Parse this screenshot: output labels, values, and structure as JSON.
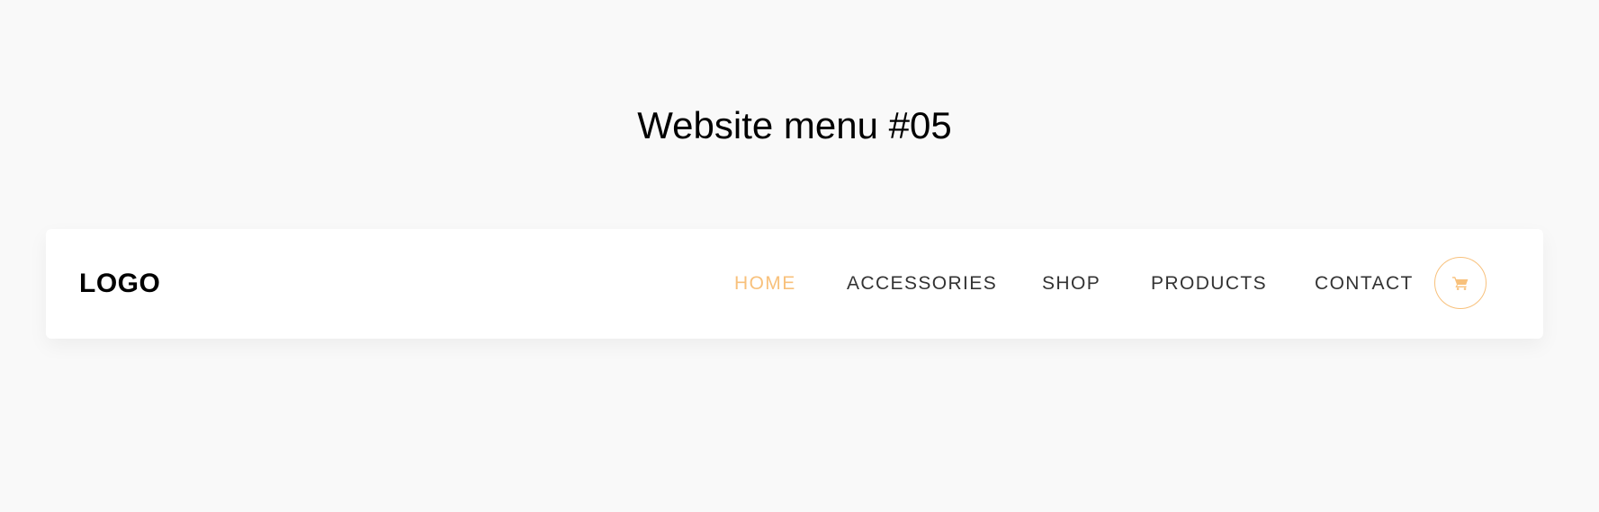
{
  "page": {
    "title": "Website menu #05"
  },
  "navbar": {
    "logo": "LOGO",
    "items": [
      {
        "label": "HOME",
        "active": true
      },
      {
        "label": "ACCESSORIES",
        "active": false
      },
      {
        "label": "SHOP",
        "active": false
      },
      {
        "label": "PRODUCTS",
        "active": false
      },
      {
        "label": "CONTACT",
        "active": false
      }
    ],
    "cart_icon": "shopping-cart-icon"
  },
  "colors": {
    "accent": "#f8c17c",
    "text": "#333333",
    "background": "#f9f9f9",
    "navbar_background": "#ffffff"
  }
}
